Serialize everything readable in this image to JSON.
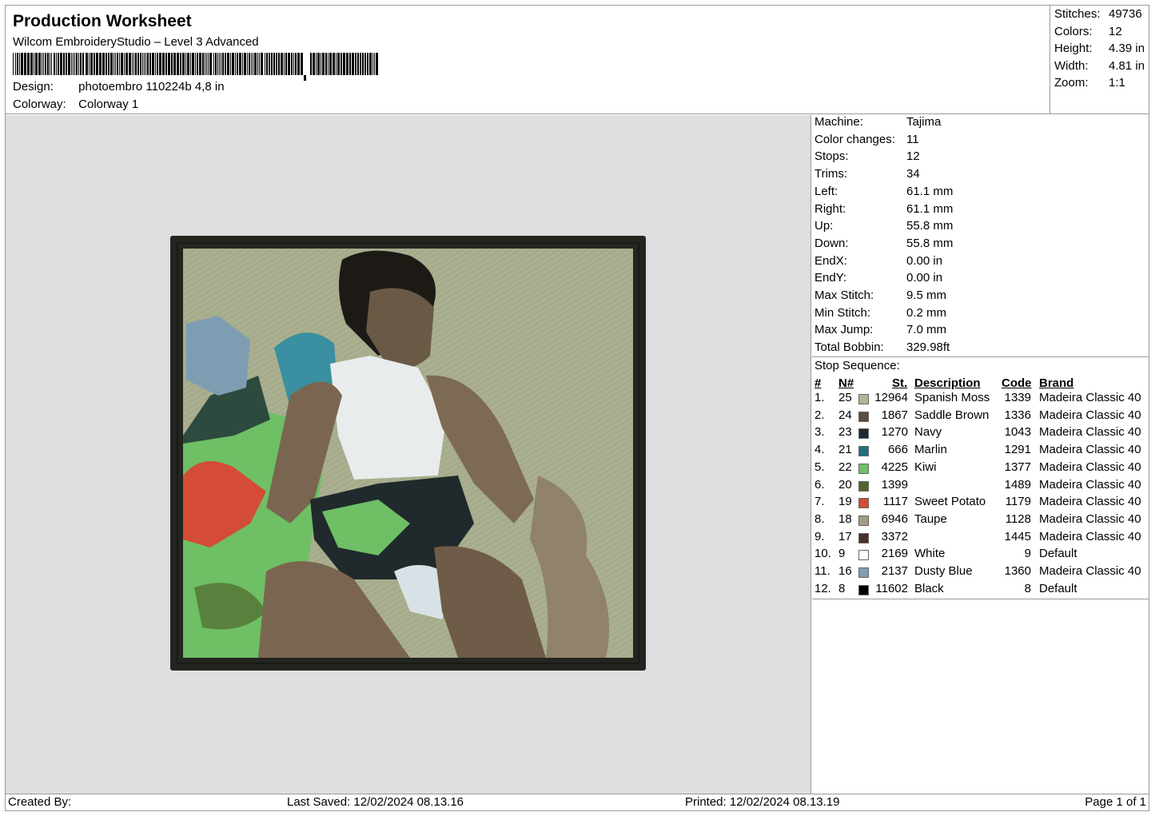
{
  "header": {
    "title": "Production Worksheet",
    "software": "Wilcom EmbroideryStudio – Level 3 Advanced",
    "design_label": "Design:",
    "design_value": "photoembro 110224b 4,8 in",
    "colorway_label": "Colorway:",
    "colorway_value": "Colorway 1"
  },
  "summary": [
    {
      "label": "Stitches:",
      "value": "49736"
    },
    {
      "label": "Colors:",
      "value": "12"
    },
    {
      "label": "Height:",
      "value": "4.39 in"
    },
    {
      "label": "Width:",
      "value": "4.81 in"
    },
    {
      "label": "Zoom:",
      "value": "1:1"
    }
  ],
  "specs": [
    {
      "label": "Machine:",
      "value": "Tajima"
    },
    {
      "label": "Color changes:",
      "value": "11"
    },
    {
      "label": "Stops:",
      "value": "12"
    },
    {
      "label": "Trims:",
      "value": "34"
    },
    {
      "label": "Left:",
      "value": "61.1 mm"
    },
    {
      "label": "Right:",
      "value": "61.1 mm"
    },
    {
      "label": "Up:",
      "value": "55.8 mm"
    },
    {
      "label": "Down:",
      "value": "55.8 mm"
    },
    {
      "label": "EndX:",
      "value": "0.00 in"
    },
    {
      "label": "EndY:",
      "value": "0.00 in"
    },
    {
      "label": "Max Stitch:",
      "value": "9.5 mm"
    },
    {
      "label": "Min Stitch:",
      "value": "0.2 mm"
    },
    {
      "label": "Max Jump:",
      "value": "7.0 mm"
    },
    {
      "label": "Total Bobbin:",
      "value": "329.98ft"
    }
  ],
  "stop_sequence": {
    "title": "Stop Sequence:",
    "headers": {
      "idx": "#",
      "n": "N#",
      "st": "St.",
      "desc": "Description",
      "code": "Code",
      "brand": "Brand"
    },
    "rows": [
      {
        "idx": "1.",
        "n": "25",
        "color": "#b3b49b",
        "st": "12964",
        "desc": "Spanish Moss",
        "code": "1339",
        "brand": "Madeira Classic 40"
      },
      {
        "idx": "2.",
        "n": "24",
        "color": "#5e4c3e",
        "st": "1867",
        "desc": "Saddle Brown",
        "code": "1336",
        "brand": "Madeira Classic 40"
      },
      {
        "idx": "3.",
        "n": "23",
        "color": "#1c2a38",
        "st": "1270",
        "desc": "Navy",
        "code": "1043",
        "brand": "Madeira Classic 40"
      },
      {
        "idx": "4.",
        "n": "21",
        "color": "#1f7080",
        "st": "666",
        "desc": "Marlin",
        "code": "1291",
        "brand": "Madeira Classic 40"
      },
      {
        "idx": "5.",
        "n": "22",
        "color": "#6fc16a",
        "st": "4225",
        "desc": "Kiwi",
        "code": "1377",
        "brand": "Madeira Classic 40"
      },
      {
        "idx": "6.",
        "n": "20",
        "color": "#50662c",
        "st": "1399",
        "desc": "",
        "code": "1489",
        "brand": "Madeira Classic 40"
      },
      {
        "idx": "7.",
        "n": "19",
        "color": "#d44b36",
        "st": "1117",
        "desc": "Sweet Potato",
        "code": "1179",
        "brand": "Madeira Classic 40"
      },
      {
        "idx": "8.",
        "n": "18",
        "color": "#a59a88",
        "st": "6946",
        "desc": "Taupe",
        "code": "1128",
        "brand": "Madeira Classic 40"
      },
      {
        "idx": "9.",
        "n": "17",
        "color": "#4a2f28",
        "st": "3372",
        "desc": "",
        "code": "1445",
        "brand": "Madeira Classic 40"
      },
      {
        "idx": "10.",
        "n": "9",
        "color": "#ffffff",
        "st": "2169",
        "desc": "White",
        "code": "9",
        "brand": "Default"
      },
      {
        "idx": "11.",
        "n": "16",
        "color": "#7f9db2",
        "st": "2137",
        "desc": "Dusty Blue",
        "code": "1360",
        "brand": "Madeira Classic 40"
      },
      {
        "idx": "12.",
        "n": "8",
        "color": "#000000",
        "st": "11602",
        "desc": "Black",
        "code": "8",
        "brand": "Default"
      }
    ]
  },
  "footer": {
    "created_by": "Created By:",
    "last_saved": "Last Saved: 12/02/2024 08.13.16",
    "printed": "Printed: 12/02/2024 08.13.19",
    "page": "Page 1 of 1"
  },
  "colors": {
    "border_dark": "#23251f",
    "background_sage": "#a9af8f",
    "preview_bg": "#dedede"
  }
}
